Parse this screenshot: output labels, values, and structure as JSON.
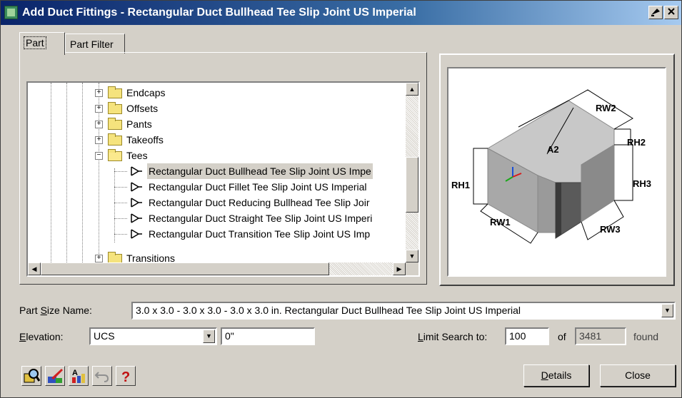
{
  "window": {
    "title": "Add Duct Fittings - Rectangular Duct Bullhead Tee Slip Joint US Imperial",
    "icon": "app-icon",
    "controls": [
      {
        "name": "help-button",
        "label": "?"
      },
      {
        "name": "close-window-button",
        "label": "✕"
      }
    ]
  },
  "tabs": [
    {
      "label": "Part",
      "active": true
    },
    {
      "label": "Part Filter",
      "active": false
    }
  ],
  "tree": {
    "folders": [
      "Endcaps",
      "Offsets",
      "Pants",
      "Takeoffs",
      "Tees",
      "Transitions"
    ],
    "expanded_folder": "Tees",
    "items": [
      "Rectangular Duct Bullhead Tee Slip Joint US Impe",
      "Rectangular Duct Fillet Tee Slip Joint US Imperial",
      "Rectangular Duct Reducing Bullhead Tee Slip Joir",
      "Rectangular Duct Straight Tee Slip Joint US Imperi",
      "Rectangular Duct Transition Tee Slip Joint US Imp"
    ],
    "selected_index": 0
  },
  "preview": {
    "labels": [
      "RW2",
      "A2",
      "RH2",
      "RH1",
      "RH3",
      "RW1",
      "RW3"
    ],
    "colors": {
      "top": "#c8c8c8",
      "left": "#a8a8a8",
      "right": "#8a8a8a",
      "dark": "#3a3a3a"
    }
  },
  "form": {
    "part_size_label_pre": "Part ",
    "part_size_label_u": "S",
    "part_size_label_post": "ize Name:",
    "part_size_value": "3.0 x 3.0 - 3.0 x 3.0 - 3.0 x 3.0 in. Rectangular Duct Bullhead Tee Slip Joint US Imperial",
    "elevation_label_u": "E",
    "elevation_label_post": "levation:",
    "elevation_select": "UCS",
    "elevation_value": "0\"",
    "limit_label_u": "L",
    "limit_label_post": "imit Search to:",
    "limit_value": "100",
    "of_label": "of",
    "found_count": "3481",
    "found_label": "found"
  },
  "buttons": {
    "details_u": "D",
    "details_post": "etails",
    "close": "Close"
  },
  "toolbar_icons": [
    "catalog-browser-icon",
    "part-builder-icon",
    "content-builder-icon",
    "undo-icon",
    "help-icon"
  ]
}
